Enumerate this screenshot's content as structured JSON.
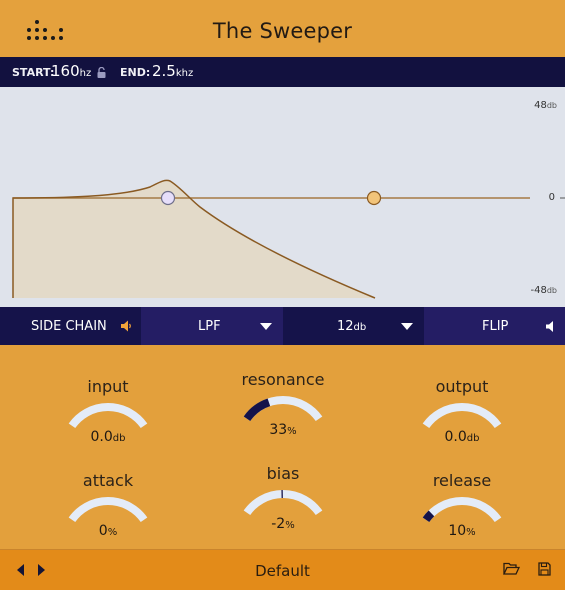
{
  "header": {
    "title": "The Sweeper",
    "logo_icon": "dot-grid-logo"
  },
  "range": {
    "start_label": "START:",
    "start_value": "160",
    "start_unit": "hz",
    "lock_icon": "unlocked-lock-icon",
    "end_label": "END:",
    "end_value": "2.5",
    "end_unit": "khz"
  },
  "graph": {
    "axis_top": "48",
    "axis_top_unit": "db",
    "axis_mid": "0",
    "axis_bottom": "-48",
    "axis_bottom_unit": "db",
    "colors": {
      "curve": "#8A5A22",
      "fill": "#E3DAC9",
      "start_handle": "#E6DEFA",
      "end_handle": "#F2C47A"
    }
  },
  "toolbar": {
    "side_chain_label": "SIDE CHAIN",
    "side_chain_icon": "speaker-icon",
    "filter_type": "LPF",
    "slope": "12",
    "slope_unit": "db",
    "flip_label": "FLIP",
    "flip_icon": "speaker-icon"
  },
  "knobs": [
    {
      "name": "input",
      "value": "0.0",
      "unit": "db",
      "fraction": 0.5
    },
    {
      "name": "resonance",
      "value": "33",
      "unit": "%",
      "fraction": 0.33
    },
    {
      "name": "output",
      "value": "0.0",
      "unit": "db",
      "fraction": 0.5
    },
    {
      "name": "attack",
      "value": "0",
      "unit": "%",
      "fraction": 0.0
    },
    {
      "name": "bias",
      "value": "-2",
      "unit": "%",
      "fraction": 0.49
    },
    {
      "name": "release",
      "value": "10",
      "unit": "%",
      "fraction": 0.1
    }
  ],
  "footer": {
    "preset_name": "Default",
    "prev_icon": "triangle-left-icon",
    "next_icon": "triangle-right-icon",
    "open_icon": "folder-open-icon",
    "save_icon": "floppy-disk-icon"
  },
  "colors": {
    "accent_orange": "#E3A03C",
    "navy": "#12113F",
    "track": "#E4ECF8",
    "knob_fill": "#15134A"
  }
}
